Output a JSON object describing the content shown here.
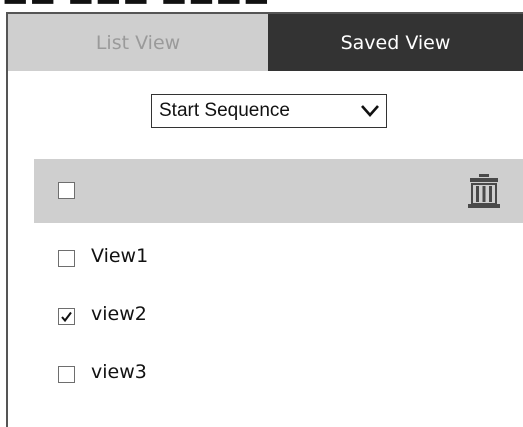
{
  "tabs": [
    {
      "label": "List View",
      "active": false
    },
    {
      "label": "Saved View",
      "active": true
    }
  ],
  "sequence_select": {
    "value": "Start Sequence"
  },
  "list": {
    "header": {
      "checked": false
    },
    "views": [
      {
        "label": "View1",
        "checked": false
      },
      {
        "label": "view2",
        "checked": true
      },
      {
        "label": "view3",
        "checked": false
      }
    ]
  },
  "colors": {
    "active_tab_bg": "#333333",
    "inactive_tab_bg": "#cfcfcf",
    "header_bg": "#cfcfcf",
    "border": "#555555"
  },
  "icons": {
    "dropdown": "chevron-down-icon",
    "delete": "trash-icon",
    "check": "checkmark-icon"
  }
}
